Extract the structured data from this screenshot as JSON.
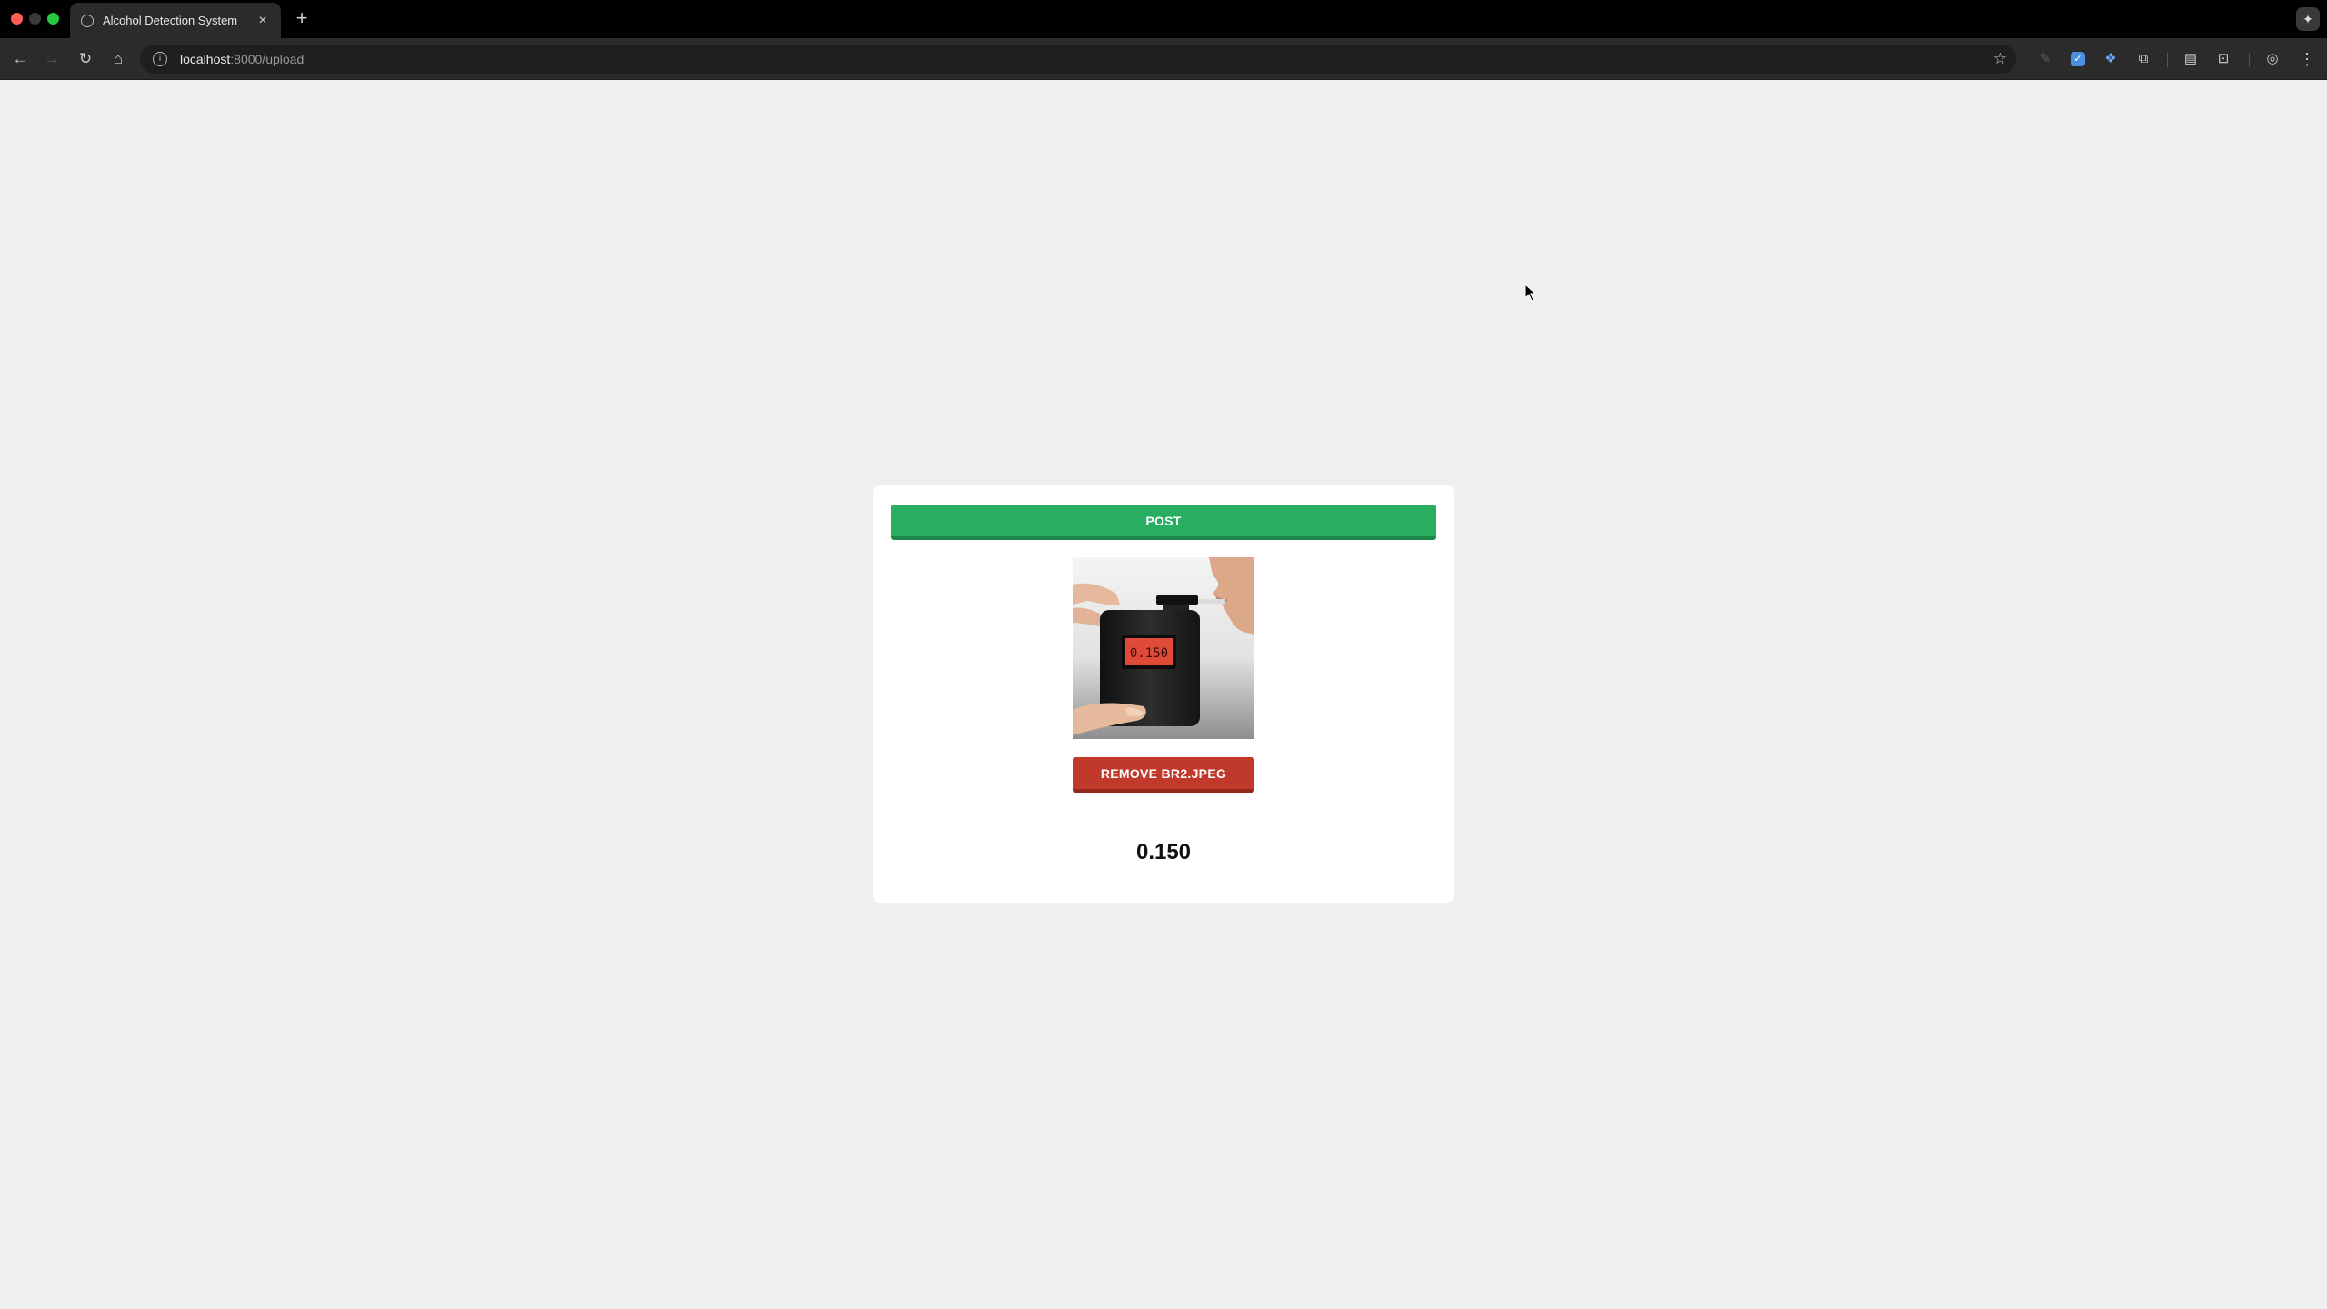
{
  "browser": {
    "tab_title": "Alcohol Detection System",
    "tab_close": "×",
    "new_tab": "+",
    "url_host": "localhost",
    "url_rest": ":8000/upload"
  },
  "page": {
    "post_label": "POST",
    "remove_label": "REMOVE BR2.JPEG",
    "result_value": "0.150",
    "image": {
      "alt": "breathalyzer-photo",
      "display_reading": "0.150"
    }
  },
  "colors": {
    "post_button": "#27ae60",
    "remove_button": "#c0392b",
    "page_background": "#efefef",
    "card_background": "#ffffff"
  }
}
